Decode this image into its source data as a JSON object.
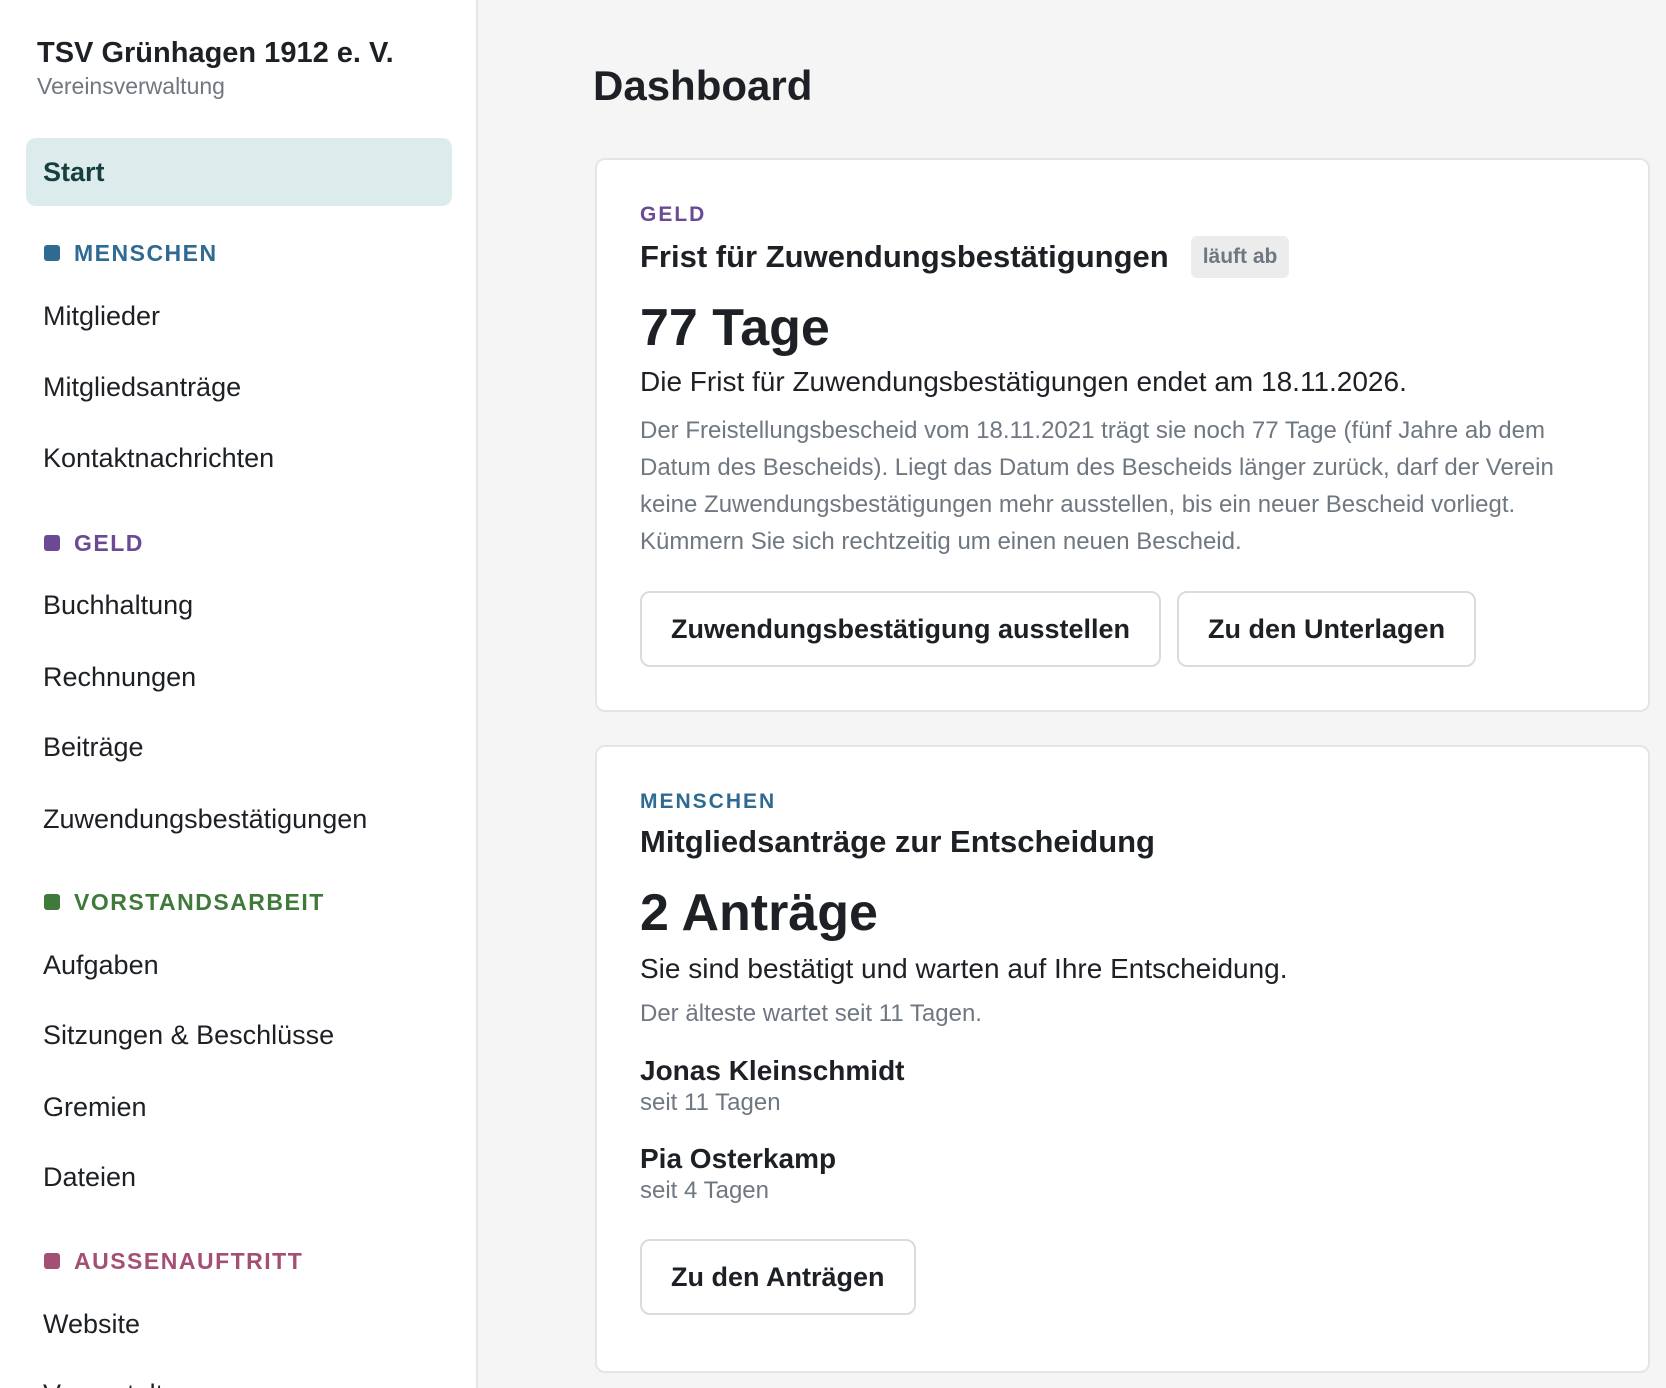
{
  "org": {
    "name": "TSV Grünhagen 1912 e. V.",
    "subtitle": "Vereinsverwaltung"
  },
  "nav": {
    "start": "Start",
    "menschen": {
      "label": "MENSCHEN",
      "color": "#2f6a93",
      "items": [
        "Mitglieder",
        "Mitgliedsanträge",
        "Kontaktnachrichten"
      ]
    },
    "geld": {
      "label": "GELD",
      "color": "#6a4a94",
      "items": [
        "Buchhaltung",
        "Rechnungen",
        "Beiträge",
        "Zuwendungsbestätigungen"
      ]
    },
    "vorstand": {
      "label": "VORSTANDSARBEIT",
      "color": "#3f7a3a",
      "items": [
        "Aufgaben",
        "Sitzungen & Beschlüsse",
        "Gremien",
        "Dateien"
      ]
    },
    "aussen": {
      "label": "AUSSENAUFTRITT",
      "color": "#a44f74",
      "items": [
        "Website",
        "Veranstaltungen"
      ]
    }
  },
  "page_title": "Dashboard",
  "card_deadline": {
    "category": "GELD",
    "title": "Frist für Zuwendungsbestätigungen",
    "badge": "läuft ab",
    "big": "77 Tage",
    "lead": "Die Frist für Zuwendungsbestätigungen endet am 18.11.2026.",
    "desc": "Der Freistellungsbescheid vom 18.11.2021 trägt sie noch 77 Tage (fünf Jahre ab dem Datum des Bescheids). Liegt das Datum des Bescheids länger zurück, darf der Verein keine Zuwendungsbestätigungen mehr ausstellen, bis ein neuer Bescheid vorliegt. Kümmern Sie sich rechtzeitig um einen neuen Bescheid.",
    "btn_primary": "Zuwendungsbestätigung ausstellen",
    "btn_secondary": "Zu den Unterlagen"
  },
  "card_applications": {
    "category": "MENSCHEN",
    "title": "Mitgliedsanträge zur Entscheidung",
    "big": "2 Anträge",
    "lead": "Sie sind bestätigt und warten auf Ihre Entscheidung.",
    "desc": "Der älteste wartet seit 11 Tagen.",
    "people": [
      {
        "name": "Jonas Kleinschmidt",
        "since": "seit 11 Tagen"
      },
      {
        "name": "Pia Osterkamp",
        "since": "seit 4 Tagen"
      }
    ],
    "btn": "Zu den Anträgen"
  }
}
